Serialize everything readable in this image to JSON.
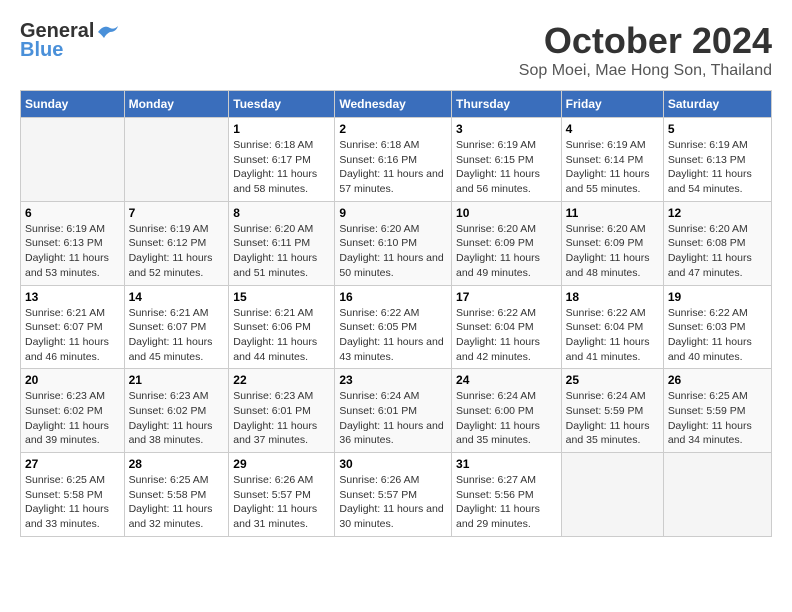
{
  "header": {
    "logo_general": "General",
    "logo_blue": "Blue",
    "month": "October 2024",
    "location": "Sop Moei, Mae Hong Son, Thailand"
  },
  "weekdays": [
    "Sunday",
    "Monday",
    "Tuesday",
    "Wednesday",
    "Thursday",
    "Friday",
    "Saturday"
  ],
  "weeks": [
    [
      {
        "day": "",
        "info": ""
      },
      {
        "day": "",
        "info": ""
      },
      {
        "day": "1",
        "info": "Sunrise: 6:18 AM\nSunset: 6:17 PM\nDaylight: 11 hours and 58 minutes."
      },
      {
        "day": "2",
        "info": "Sunrise: 6:18 AM\nSunset: 6:16 PM\nDaylight: 11 hours and 57 minutes."
      },
      {
        "day": "3",
        "info": "Sunrise: 6:19 AM\nSunset: 6:15 PM\nDaylight: 11 hours and 56 minutes."
      },
      {
        "day": "4",
        "info": "Sunrise: 6:19 AM\nSunset: 6:14 PM\nDaylight: 11 hours and 55 minutes."
      },
      {
        "day": "5",
        "info": "Sunrise: 6:19 AM\nSunset: 6:13 PM\nDaylight: 11 hours and 54 minutes."
      }
    ],
    [
      {
        "day": "6",
        "info": "Sunrise: 6:19 AM\nSunset: 6:13 PM\nDaylight: 11 hours and 53 minutes."
      },
      {
        "day": "7",
        "info": "Sunrise: 6:19 AM\nSunset: 6:12 PM\nDaylight: 11 hours and 52 minutes."
      },
      {
        "day": "8",
        "info": "Sunrise: 6:20 AM\nSunset: 6:11 PM\nDaylight: 11 hours and 51 minutes."
      },
      {
        "day": "9",
        "info": "Sunrise: 6:20 AM\nSunset: 6:10 PM\nDaylight: 11 hours and 50 minutes."
      },
      {
        "day": "10",
        "info": "Sunrise: 6:20 AM\nSunset: 6:09 PM\nDaylight: 11 hours and 49 minutes."
      },
      {
        "day": "11",
        "info": "Sunrise: 6:20 AM\nSunset: 6:09 PM\nDaylight: 11 hours and 48 minutes."
      },
      {
        "day": "12",
        "info": "Sunrise: 6:20 AM\nSunset: 6:08 PM\nDaylight: 11 hours and 47 minutes."
      }
    ],
    [
      {
        "day": "13",
        "info": "Sunrise: 6:21 AM\nSunset: 6:07 PM\nDaylight: 11 hours and 46 minutes."
      },
      {
        "day": "14",
        "info": "Sunrise: 6:21 AM\nSunset: 6:07 PM\nDaylight: 11 hours and 45 minutes."
      },
      {
        "day": "15",
        "info": "Sunrise: 6:21 AM\nSunset: 6:06 PM\nDaylight: 11 hours and 44 minutes."
      },
      {
        "day": "16",
        "info": "Sunrise: 6:22 AM\nSunset: 6:05 PM\nDaylight: 11 hours and 43 minutes."
      },
      {
        "day": "17",
        "info": "Sunrise: 6:22 AM\nSunset: 6:04 PM\nDaylight: 11 hours and 42 minutes."
      },
      {
        "day": "18",
        "info": "Sunrise: 6:22 AM\nSunset: 6:04 PM\nDaylight: 11 hours and 41 minutes."
      },
      {
        "day": "19",
        "info": "Sunrise: 6:22 AM\nSunset: 6:03 PM\nDaylight: 11 hours and 40 minutes."
      }
    ],
    [
      {
        "day": "20",
        "info": "Sunrise: 6:23 AM\nSunset: 6:02 PM\nDaylight: 11 hours and 39 minutes."
      },
      {
        "day": "21",
        "info": "Sunrise: 6:23 AM\nSunset: 6:02 PM\nDaylight: 11 hours and 38 minutes."
      },
      {
        "day": "22",
        "info": "Sunrise: 6:23 AM\nSunset: 6:01 PM\nDaylight: 11 hours and 37 minutes."
      },
      {
        "day": "23",
        "info": "Sunrise: 6:24 AM\nSunset: 6:01 PM\nDaylight: 11 hours and 36 minutes."
      },
      {
        "day": "24",
        "info": "Sunrise: 6:24 AM\nSunset: 6:00 PM\nDaylight: 11 hours and 35 minutes."
      },
      {
        "day": "25",
        "info": "Sunrise: 6:24 AM\nSunset: 5:59 PM\nDaylight: 11 hours and 35 minutes."
      },
      {
        "day": "26",
        "info": "Sunrise: 6:25 AM\nSunset: 5:59 PM\nDaylight: 11 hours and 34 minutes."
      }
    ],
    [
      {
        "day": "27",
        "info": "Sunrise: 6:25 AM\nSunset: 5:58 PM\nDaylight: 11 hours and 33 minutes."
      },
      {
        "day": "28",
        "info": "Sunrise: 6:25 AM\nSunset: 5:58 PM\nDaylight: 11 hours and 32 minutes."
      },
      {
        "day": "29",
        "info": "Sunrise: 6:26 AM\nSunset: 5:57 PM\nDaylight: 11 hours and 31 minutes."
      },
      {
        "day": "30",
        "info": "Sunrise: 6:26 AM\nSunset: 5:57 PM\nDaylight: 11 hours and 30 minutes."
      },
      {
        "day": "31",
        "info": "Sunrise: 6:27 AM\nSunset: 5:56 PM\nDaylight: 11 hours and 29 minutes."
      },
      {
        "day": "",
        "info": ""
      },
      {
        "day": "",
        "info": ""
      }
    ]
  ]
}
